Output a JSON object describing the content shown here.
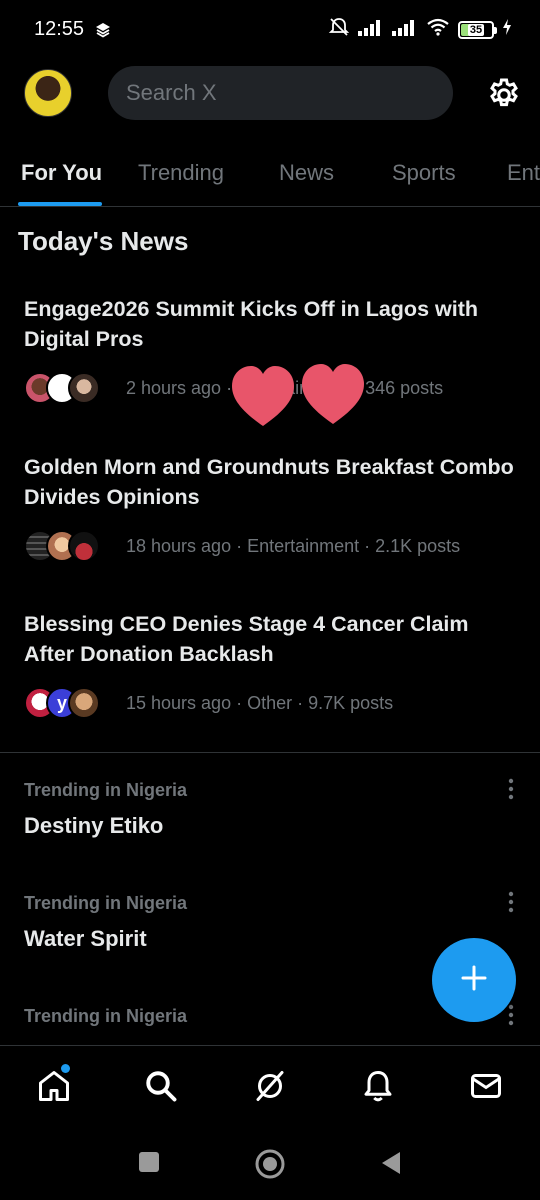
{
  "status": {
    "time": "12:55",
    "battery": "35"
  },
  "search": {
    "placeholder": "Search X"
  },
  "tabs": [
    {
      "label": "For You"
    },
    {
      "label": "Trending"
    },
    {
      "label": "News"
    },
    {
      "label": "Sports"
    },
    {
      "label": "Ent"
    }
  ],
  "section_title": "Today's News",
  "news": [
    {
      "headline": "Engage2026 Summit Kicks Off in Lagos with Digital Pros",
      "meta": "2 hours ago · Entertainment · 346 posts"
    },
    {
      "headline": "Golden Morn and Groundnuts Breakfast Combo Divides Opinions",
      "meta": "18 hours ago · Entertainment · 2.1K posts"
    },
    {
      "headline": "Blessing CEO Denies Stage 4 Cancer Claim After Donation Backlash",
      "meta": "15 hours ago · Other · 9.7K posts"
    }
  ],
  "trends": [
    {
      "context": "Trending in Nigeria",
      "title": "Destiny Etiko"
    },
    {
      "context": "Trending in Nigeria",
      "title": "Water Spirit"
    },
    {
      "context": "Trending in Nigeria",
      "title": ""
    }
  ],
  "colors": {
    "accent": "#1d9bf0",
    "heart": "#e8556a",
    "background": "#000000"
  },
  "icons": {
    "nav": [
      "home-icon",
      "search-icon",
      "grok-icon",
      "bell-icon",
      "mail-icon"
    ],
    "fab": "plus-icon",
    "settings": "gear-icon"
  }
}
